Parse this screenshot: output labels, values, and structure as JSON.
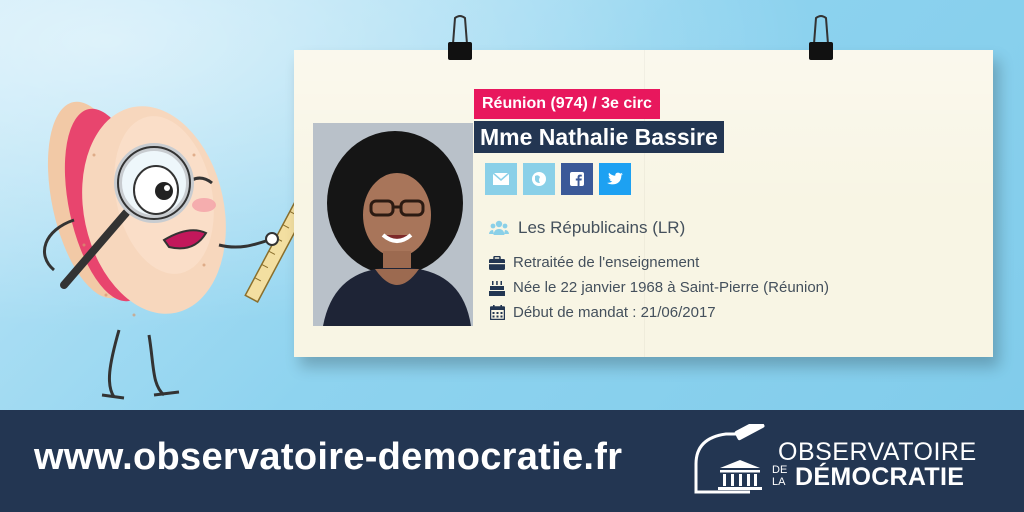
{
  "card": {
    "circonscription": "Réunion (974) / 3e circ",
    "name": "Mme Nathalie Bassire",
    "social": [
      {
        "icon": "envelope-icon",
        "color": "#8ad0e8"
      },
      {
        "icon": "globe-icon",
        "color": "#8ad0e8"
      },
      {
        "icon": "facebook-icon",
        "color": "#3b5998"
      },
      {
        "icon": "twitter-icon",
        "color": "#1da1f2"
      }
    ],
    "party": {
      "icon": "group-icon",
      "text": "Les Républicains (LR)"
    },
    "details": [
      {
        "icon": "briefcase-icon",
        "text": "Retraitée de l'enseignement"
      },
      {
        "icon": "birthday-cake-icon",
        "text": "Née le 22 janvier 1968 à Saint-Pierre (Réunion)"
      },
      {
        "icon": "calendar-icon",
        "text": "Début de mandat : 21/06/2017"
      }
    ]
  },
  "footer": {
    "url": "www.observatoire-democratie.fr",
    "logo": {
      "line1": "OBSERVATOIRE",
      "de": "DE",
      "la": "LA",
      "line2": "DÉMOCRATIE"
    }
  },
  "colors": {
    "circ_bg": "#e8175d",
    "name_bg": "#233652",
    "footer_bg": "#233652",
    "card_bg": "#f8f5e4",
    "icon_blue": "#8ad0e8"
  }
}
